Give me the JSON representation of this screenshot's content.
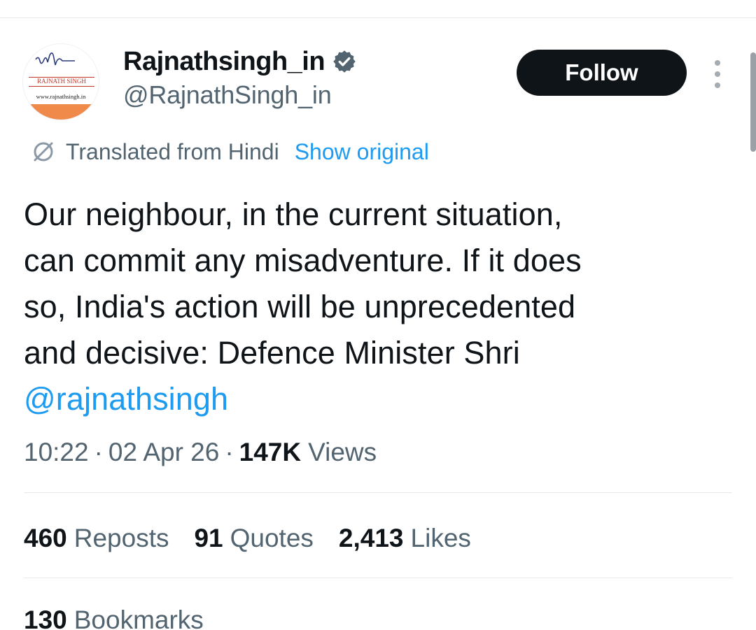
{
  "author": {
    "display_name": "Rajnathsingh_in",
    "handle": "@RajnathSingh_in",
    "avatar_text_top": "RAJNATH SINGH",
    "avatar_text_bottom": "www.rajnathsingh.in",
    "verified": true,
    "verified_color": "#536471"
  },
  "actions": {
    "follow_label": "Follow"
  },
  "translation": {
    "label": "Translated from Hindi",
    "show_original_label": "Show original"
  },
  "tweet": {
    "lines": [
      "Our neighbour, in the current situation,",
      "can commit any misadventure. If it does",
      "so, India's action will be unprecedented",
      "and decisive: Defence Minister Shri"
    ],
    "mention": "@rajnathsingh"
  },
  "meta": {
    "time": "10:22",
    "separator": "·",
    "date": "02 Apr 26",
    "views_count": "147K",
    "views_label": "Views"
  },
  "stats": {
    "reposts_count": "460",
    "reposts_label": "Reposts",
    "quotes_count": "91",
    "quotes_label": "Quotes",
    "likes_count": "2,413",
    "likes_label": "Likes",
    "bookmarks_count": "130",
    "bookmarks_label": "Bookmarks"
  },
  "colors": {
    "text_primary": "#0f1419",
    "text_secondary": "#536471",
    "link": "#1d9bf0",
    "follow_bg": "#0f1419",
    "avatar_accent": "#f08a4b"
  },
  "icons": {
    "verified": "verified-badge-icon",
    "translate": "translate-icon",
    "more": "more-vertical-icon"
  }
}
